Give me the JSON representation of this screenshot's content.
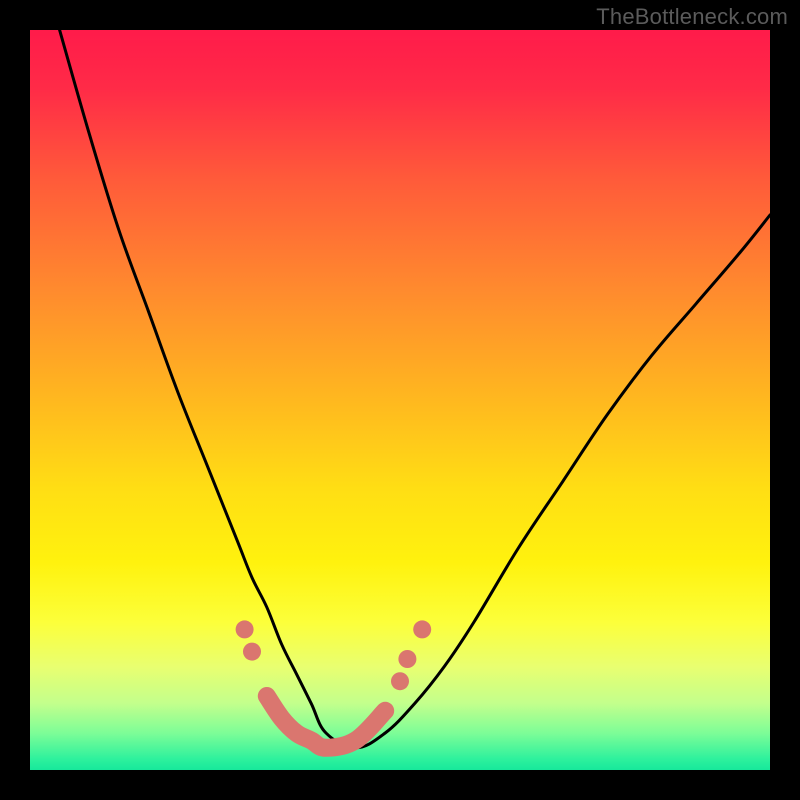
{
  "watermark": "TheBottleneck.com",
  "chart_data": {
    "type": "line",
    "title": "",
    "xlabel": "",
    "ylabel": "",
    "xlim": [
      0,
      100
    ],
    "ylim": [
      0,
      100
    ],
    "grid": false,
    "legend": false,
    "series": [
      {
        "name": "curve",
        "x": [
          4,
          8,
          12,
          16,
          20,
          24,
          28,
          30,
          32,
          34,
          36,
          38,
          40,
          44,
          48,
          52,
          56,
          60,
          66,
          72,
          78,
          84,
          90,
          96,
          100
        ],
        "y": [
          100,
          86,
          73,
          62,
          51,
          41,
          31,
          26,
          22,
          17,
          13,
          9,
          5,
          3,
          5,
          9,
          14,
          20,
          30,
          39,
          48,
          56,
          63,
          70,
          75
        ]
      }
    ],
    "highlight_segment": {
      "name": "bottom-v",
      "x": [
        32,
        34,
        36,
        38,
        40,
        44,
        48
      ],
      "y": [
        10,
        7,
        5,
        4,
        3,
        4,
        8
      ]
    },
    "highlight_points": [
      {
        "x": 29,
        "y": 19
      },
      {
        "x": 30,
        "y": 16
      },
      {
        "x": 50,
        "y": 12
      },
      {
        "x": 51,
        "y": 15
      },
      {
        "x": 53,
        "y": 19
      }
    ],
    "gradient_stops": [
      {
        "offset": 0.0,
        "color": "#ff1b4a"
      },
      {
        "offset": 0.08,
        "color": "#ff2b47"
      },
      {
        "offset": 0.2,
        "color": "#ff5a3a"
      },
      {
        "offset": 0.35,
        "color": "#ff8a2e"
      },
      {
        "offset": 0.5,
        "color": "#ffb81f"
      },
      {
        "offset": 0.62,
        "color": "#ffde14"
      },
      {
        "offset": 0.72,
        "color": "#fff20e"
      },
      {
        "offset": 0.8,
        "color": "#fcff3a"
      },
      {
        "offset": 0.86,
        "color": "#e9ff70"
      },
      {
        "offset": 0.91,
        "color": "#c3ff8c"
      },
      {
        "offset": 0.95,
        "color": "#7dfd97"
      },
      {
        "offset": 0.985,
        "color": "#2ef19d"
      },
      {
        "offset": 1.0,
        "color": "#17e89b"
      }
    ]
  }
}
